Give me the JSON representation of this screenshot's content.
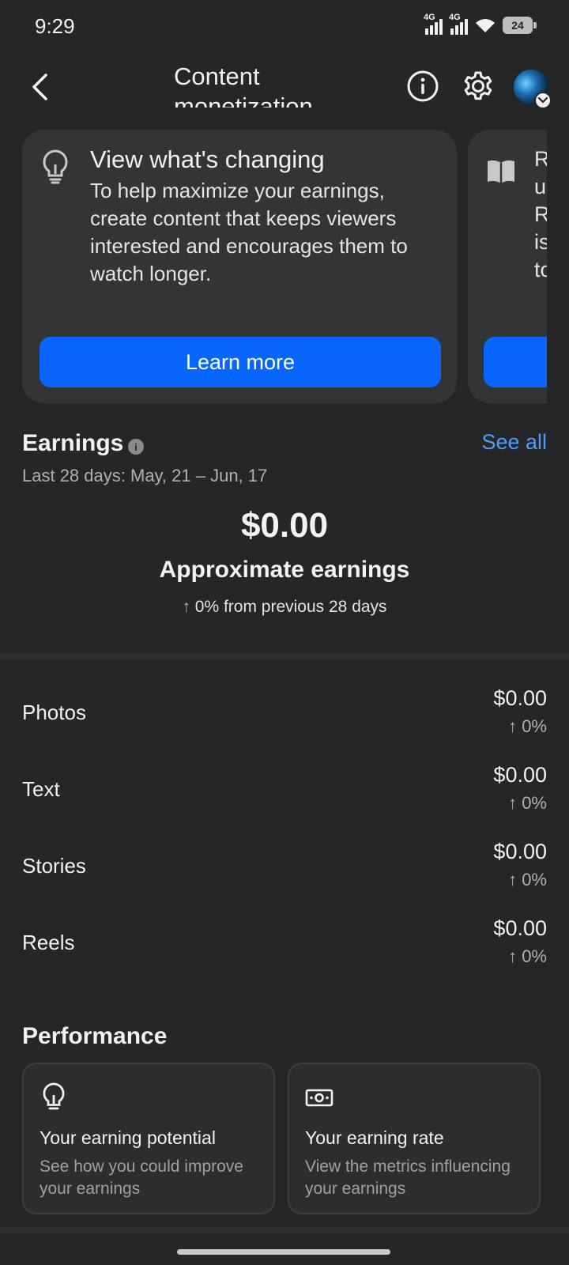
{
  "status_bar": {
    "time": "9:29",
    "network_1": "4G",
    "network_2": "4G",
    "battery": "24"
  },
  "header": {
    "title": "Content monetization",
    "icons": [
      "back-icon",
      "info-icon",
      "gear-icon",
      "avatar"
    ]
  },
  "promo_cards": [
    {
      "title": "View what's changing",
      "body": "To help maximize your earnings, create content that keeps viewers interested and encourages them to watch longer.",
      "button": "Learn more",
      "icon": "lightbulb-icon"
    },
    {
      "text_partial": "R u R is to",
      "icon": "book-icon"
    }
  ],
  "earnings": {
    "title": "Earnings",
    "see_all": "See all",
    "range_label": "Last 28 days:",
    "range_value": "May, 21 – Jun, 17",
    "total": "$0.00",
    "total_label": "Approximate earnings",
    "change_arrow": "↑",
    "change_text": "0% from previous 28 days"
  },
  "breakdown": [
    {
      "label": "Photos",
      "amount": "$0.00",
      "change": "↑ 0%"
    },
    {
      "label": "Text",
      "amount": "$0.00",
      "change": "↑ 0%"
    },
    {
      "label": "Stories",
      "amount": "$0.00",
      "change": "↑ 0%"
    },
    {
      "label": "Reels",
      "amount": "$0.00",
      "change": "↑ 0%"
    }
  ],
  "performance": {
    "title": "Performance",
    "cards": [
      {
        "name": "Your earning potential",
        "desc": "See how you could improve your earnings",
        "icon": "lightbulb-icon"
      },
      {
        "name": "Your earning rate",
        "desc": "View the metrics influencing your earnings",
        "icon": "money-icon"
      }
    ]
  },
  "colors": {
    "background": "#252628",
    "card": "#333436",
    "accent_blue": "#0866ff",
    "link_blue": "#4f9cf9"
  }
}
